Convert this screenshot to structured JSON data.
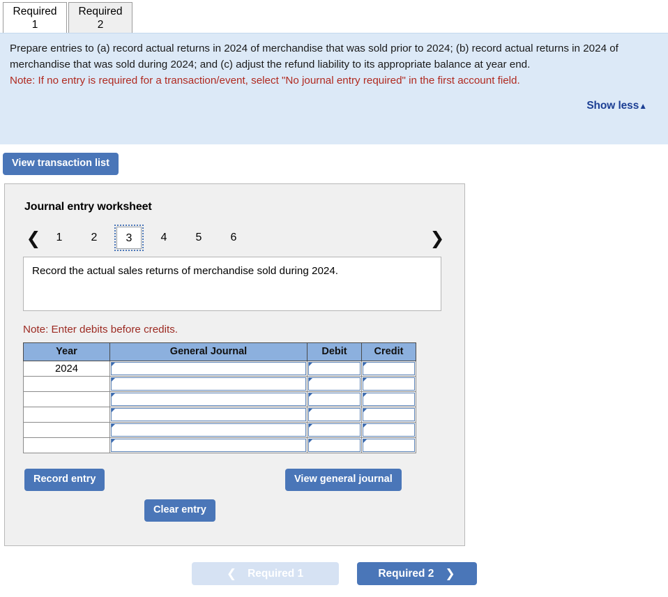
{
  "required_tabs": [
    {
      "label_line1": "Required",
      "label_line2": "1",
      "active": true
    },
    {
      "label_line1": "Required",
      "label_line2": "2",
      "active": false
    }
  ],
  "instructions": {
    "paragraph": "Prepare entries to (a) record actual returns in 2024 of merchandise that was sold prior to 2024; (b) record actual returns in 2024 of merchandise that was sold during 2024; and (c) adjust the refund liability to its appropriate balance at year end.",
    "note": "Note: If no entry is required for a transaction/event, select \"No journal entry required\" in the first account field.",
    "show_less_label": "Show less",
    "show_less_caret": "▲",
    "note_color": "#b02a20",
    "panel_color": "#dce9f7",
    "link_color": "#1c3f94"
  },
  "toolbar": {
    "view_transaction_list_label": "View transaction list"
  },
  "worksheet": {
    "title": "Journal entry worksheet",
    "pager": {
      "prev_icon": "❮",
      "next_icon": "❯",
      "pages": [
        "1",
        "2",
        "3",
        "4",
        "5",
        "6"
      ],
      "selected": "3"
    },
    "description": "Record the actual sales returns of merchandise sold during 2024.",
    "debit_note": "Note: Enter debits before credits.",
    "table": {
      "headers": [
        "Year",
        "General Journal",
        "Debit",
        "Credit"
      ],
      "rows": [
        {
          "year": "2024",
          "general_journal": "",
          "debit": "",
          "credit": ""
        },
        {
          "year": "",
          "general_journal": "",
          "debit": "",
          "credit": ""
        },
        {
          "year": "",
          "general_journal": "",
          "debit": "",
          "credit": ""
        },
        {
          "year": "",
          "general_journal": "",
          "debit": "",
          "credit": ""
        },
        {
          "year": "",
          "general_journal": "",
          "debit": "",
          "credit": ""
        },
        {
          "year": "",
          "general_journal": "",
          "debit": "",
          "credit": ""
        }
      ],
      "header_color": "#8cb0de"
    },
    "actions": {
      "record_entry_label": "Record entry",
      "clear_entry_label": "Clear entry",
      "view_general_journal_label": "View general journal"
    }
  },
  "bottom_nav": {
    "prev_label": "Required 1",
    "prev_icon": "❮",
    "prev_disabled": true,
    "next_label": "Required 2",
    "next_icon": "❯",
    "accent_color": "#4a76b8",
    "disabled_color": "#d6e2f3"
  }
}
